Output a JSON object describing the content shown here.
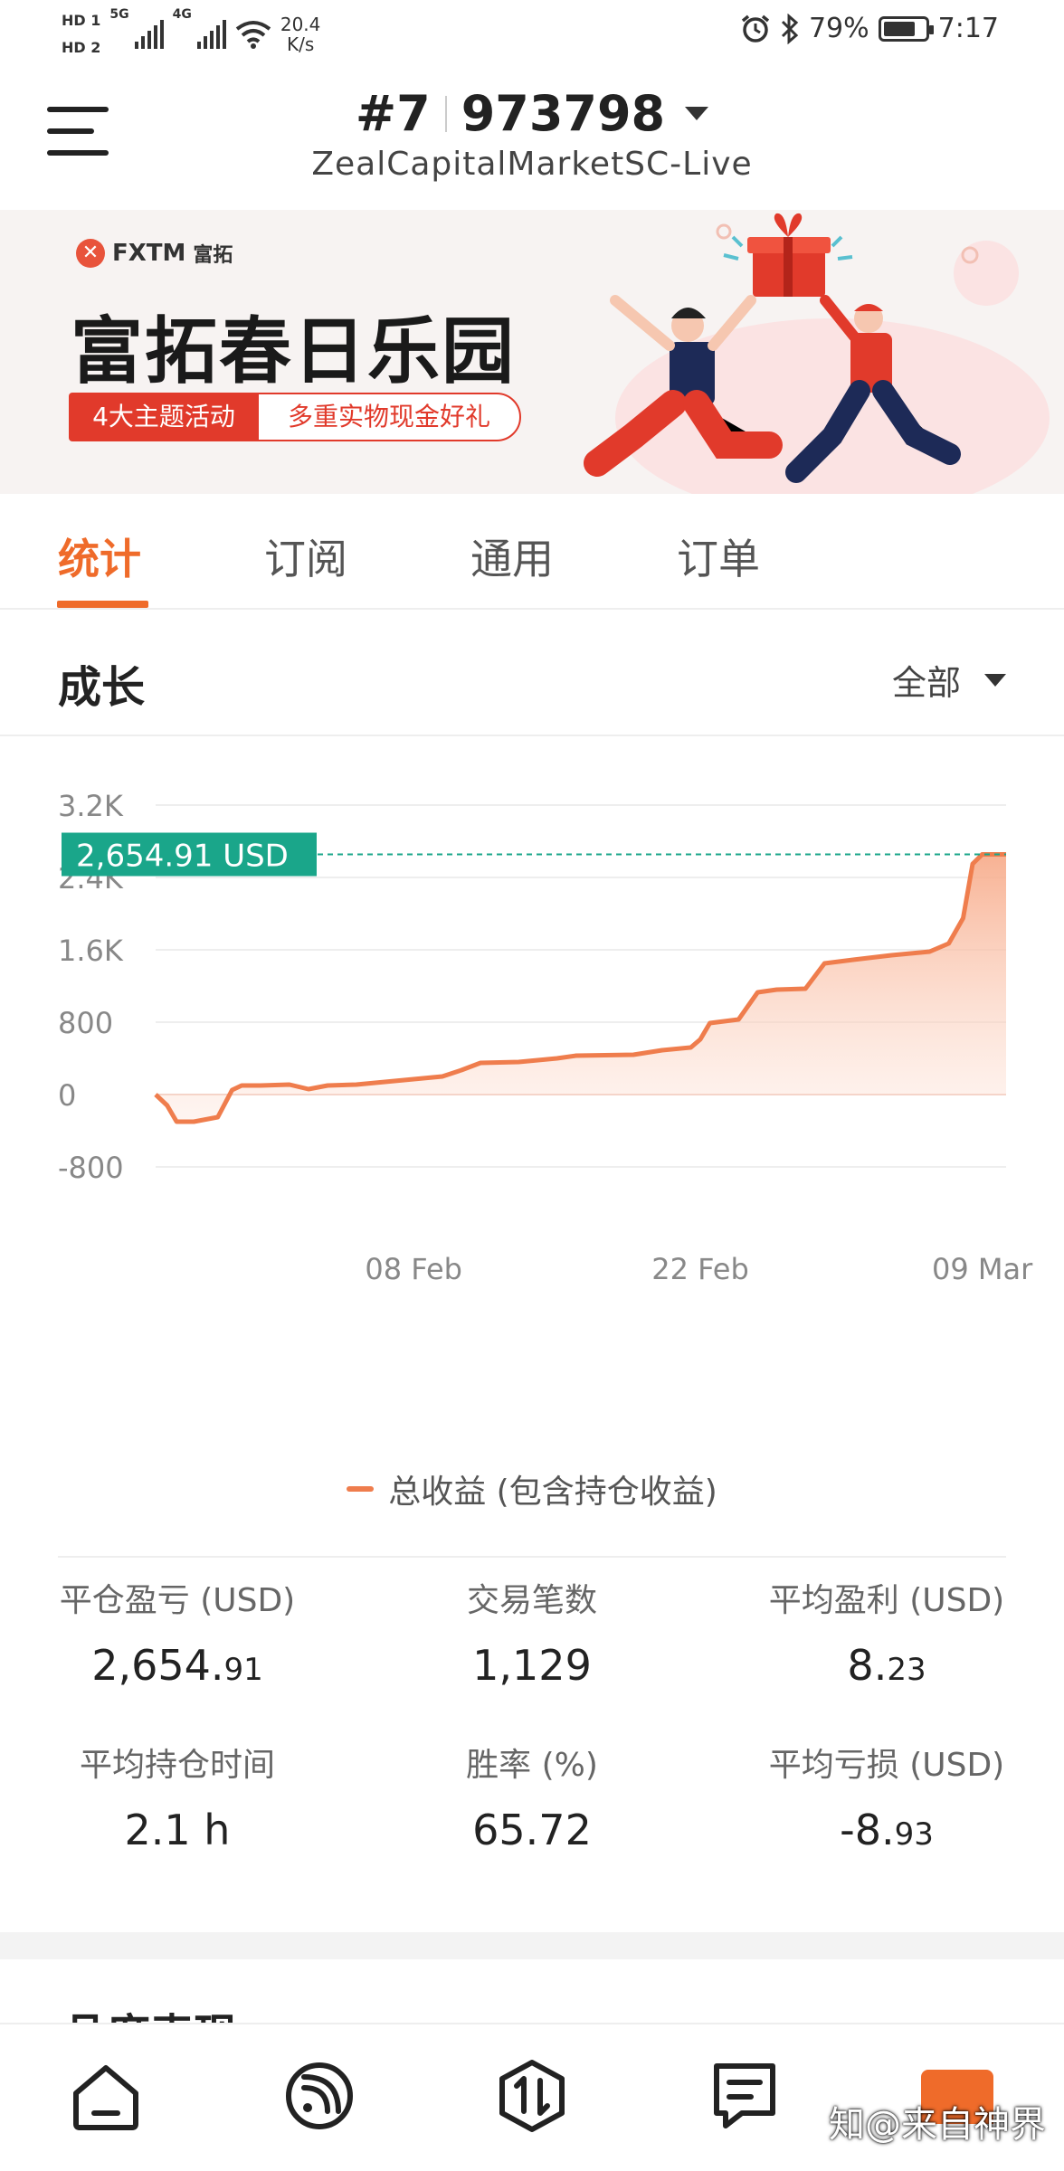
{
  "status_bar": {
    "hd1": "HD 1",
    "hd2": "HD 2",
    "gen1": "5G",
    "gen2": "4G",
    "speed_value": "20.4",
    "speed_unit": "K/s",
    "battery": "79%",
    "time": "7:17"
  },
  "header": {
    "account_index": "#7",
    "account_number": "973798",
    "server": "ZealCapitalMarketSC-Live"
  },
  "banner": {
    "brand": "FXTM",
    "brand_cn": "富拓",
    "title": "富拓春日乐园",
    "tag_primary": "4大主题活动",
    "tag_secondary": "多重实物现金好礼"
  },
  "tabs": [
    {
      "label": "统计",
      "active": true
    },
    {
      "label": "订阅",
      "active": false
    },
    {
      "label": "通用",
      "active": false
    },
    {
      "label": "订单",
      "active": false
    }
  ],
  "section": {
    "title": "成长",
    "filter": "全部"
  },
  "chart_data": {
    "type": "area",
    "series": [
      {
        "name": "总收益 (包含持仓收益)",
        "color": "#ef7d4d"
      }
    ],
    "x_ticks": [
      "08 Feb",
      "22 Feb",
      "09 Mar"
    ],
    "y_ticks": [
      "3.2K",
      "2.4K",
      "1.6K",
      "800",
      "0",
      "-800"
    ],
    "ylim": [
      -800,
      3200
    ],
    "current_value_label": "2,654.91 USD",
    "current_value": 2654.91,
    "points": [
      [
        0,
        0
      ],
      [
        1.2,
        -120
      ],
      [
        2.2,
        -300
      ],
      [
        4,
        -300
      ],
      [
        6.5,
        -250
      ],
      [
        8,
        50
      ],
      [
        9,
        100
      ],
      [
        11,
        100
      ],
      [
        14,
        110
      ],
      [
        16,
        60
      ],
      [
        18,
        100
      ],
      [
        21,
        110
      ],
      [
        24,
        140
      ],
      [
        27,
        170
      ],
      [
        30,
        200
      ],
      [
        32,
        270
      ],
      [
        34,
        350
      ],
      [
        38,
        360
      ],
      [
        42,
        400
      ],
      [
        44,
        430
      ],
      [
        50,
        440
      ],
      [
        53,
        490
      ],
      [
        56,
        520
      ],
      [
        57,
        610
      ],
      [
        58,
        790
      ],
      [
        61,
        830
      ],
      [
        63,
        1130
      ],
      [
        65,
        1160
      ],
      [
        68,
        1170
      ],
      [
        70,
        1450
      ],
      [
        73,
        1490
      ],
      [
        77,
        1540
      ],
      [
        81,
        1580
      ],
      [
        83,
        1670
      ],
      [
        84.5,
        1950
      ],
      [
        85.5,
        2550
      ],
      [
        86.5,
        2654.91
      ],
      [
        89,
        2654.91
      ]
    ],
    "x_tick_positions": [
      27,
      57,
      86.5
    ],
    "x_range": [
      0,
      89
    ]
  },
  "stats": [
    {
      "label": "平仓盈亏 (USD)",
      "value_main": "2,654.",
      "value_small": "91",
      "color": "green"
    },
    {
      "label": "交易笔数",
      "value_main": "1,129",
      "value_small": "",
      "color": "default"
    },
    {
      "label": "平均盈利 (USD)",
      "value_main": "8.",
      "value_small": "23",
      "color": "default"
    },
    {
      "label": "平均持仓时间",
      "value_main": "2.1 h",
      "value_small": "",
      "color": "default"
    },
    {
      "label": "胜率 (%)",
      "value_main": "65.72",
      "value_small": "",
      "color": "default"
    },
    {
      "label": "平均亏损 (USD)",
      "value_main": "-8.",
      "value_small": "93",
      "color": "default"
    }
  ],
  "next_section_title": "品度表现",
  "bottom_nav": [
    {
      "icon": "home-icon"
    },
    {
      "icon": "feed-icon"
    },
    {
      "icon": "trade-icon"
    },
    {
      "icon": "notes-icon"
    },
    {
      "icon": "profile-icon"
    }
  ],
  "watermark": "知@来自神界"
}
